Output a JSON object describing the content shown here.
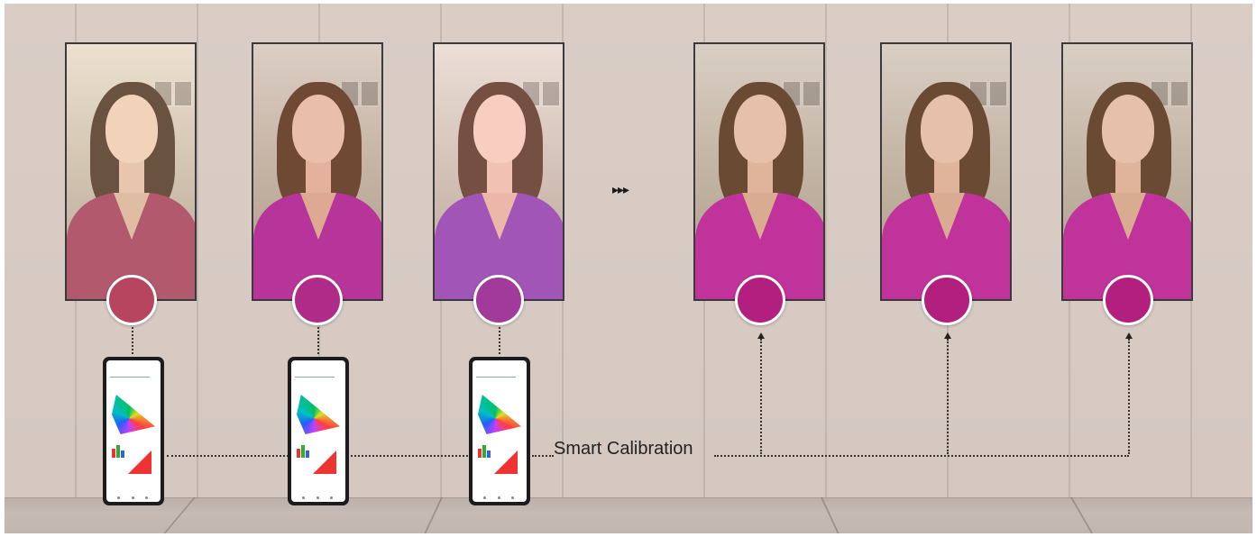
{
  "label": "Smart Calibration",
  "arrows": "▸▸▸",
  "colors": {
    "wall": "#d8ccc5",
    "floor": "#c2b6b0",
    "before_swatches": [
      "#b8455f",
      "#b02a87",
      "#a13a9a"
    ],
    "after_swatch": "#b21f7e"
  },
  "icons": [
    "play-triangle-icon",
    "arrow-up-icon",
    "color-gamut-chart-icon",
    "bar-chart-icon",
    "triangle-chart-icon"
  ]
}
